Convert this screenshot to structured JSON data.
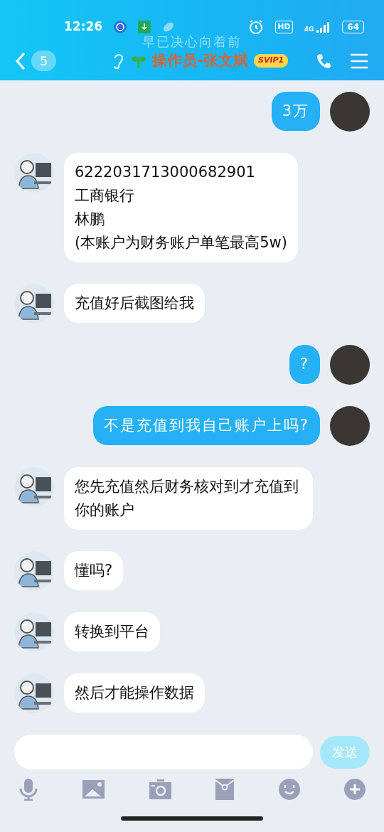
{
  "status_bar": {
    "time": "12:26",
    "hd": "HD",
    "network": "4G",
    "battery": "64"
  },
  "header": {
    "unread": "5",
    "signature": "早已决心向着前",
    "title": "操作员-张文斌",
    "badge": "SVIP1"
  },
  "messages": [
    {
      "kind": "sent",
      "text": "3万"
    },
    {
      "kind": "received",
      "text": "6222031713000682901",
      "lines": [
        "工商银行",
        "林鹏",
        "(本账户为财务账户单笔最高5w)"
      ]
    },
    {
      "kind": "received",
      "text": "充值好后截图给我"
    },
    {
      "kind": "sent",
      "text": "?"
    },
    {
      "kind": "sent",
      "text": "不是充值到我自己账户上吗?"
    },
    {
      "kind": "received",
      "text": "您先充值然后财务核对到才充值到你的账户"
    },
    {
      "kind": "received",
      "text": "懂吗?"
    },
    {
      "kind": "received",
      "text": "转换到平台"
    },
    {
      "kind": "received",
      "text": "然后才能操作数据"
    }
  ],
  "composer": {
    "send": "发送"
  }
}
